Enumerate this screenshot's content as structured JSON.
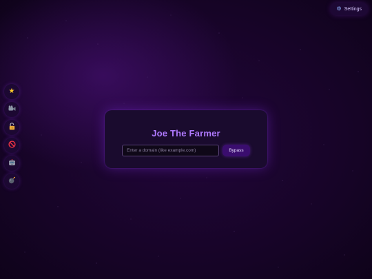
{
  "header": {
    "settings_label": "Settings",
    "settings_icon": "gear-icon"
  },
  "sidebar": {
    "items": [
      {
        "name": "star",
        "icon": "star-icon",
        "glyph": "★"
      },
      {
        "name": "camera",
        "icon": "movie-camera-icon",
        "glyph": "🎥"
      },
      {
        "name": "lock",
        "icon": "unlocked-lock-icon",
        "glyph": "🔓"
      },
      {
        "name": "no-entry",
        "icon": "no-entry-icon",
        "glyph": "🚫"
      },
      {
        "name": "robot",
        "icon": "robot-icon",
        "glyph": "🤖"
      },
      {
        "name": "bomb",
        "icon": "bomb-icon",
        "glyph": "💣"
      }
    ]
  },
  "card": {
    "title": "Joe The Farmer",
    "input_placeholder": "Enter a domain (like example.com)",
    "input_value": "",
    "button_label": "Bypass"
  },
  "colors": {
    "background": "#160426",
    "card": "#1a0b2e",
    "title": "#b07aff",
    "button": "#3a0d6e"
  }
}
